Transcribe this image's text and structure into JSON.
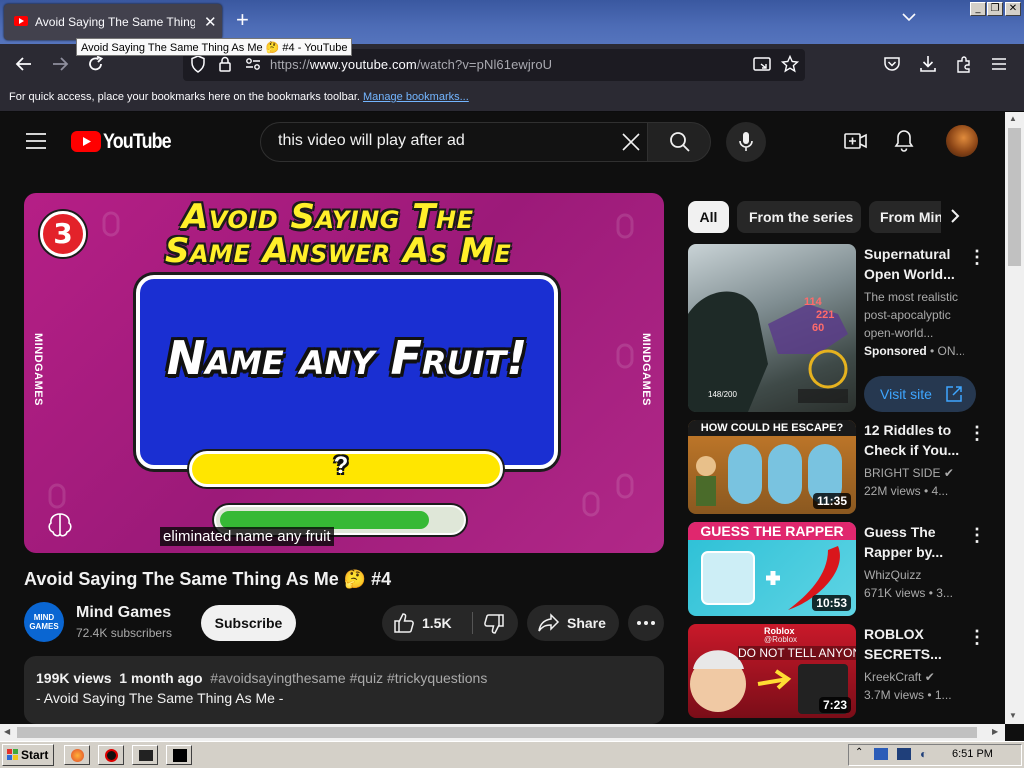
{
  "browser": {
    "tab_title": "Avoid Saying The Same Thing As Me",
    "tooltip": "Avoid Saying The Same Thing As Me 🤔 #4 - YouTube",
    "url_prefix": "https://",
    "url_host": "www.youtube.com",
    "url_path": "/watch?v=pNl61ewjroU",
    "bookmarks_hint": "For quick access, place your bookmarks here on the bookmarks toolbar.",
    "bookmarks_link": "Manage bookmarks..."
  },
  "youtube": {
    "logo_text": "YouTube",
    "search_value": "this video will play after ad"
  },
  "player": {
    "round_number": "3",
    "heading_line1": "Avoid Saying The",
    "heading_line2": "Same Answer As Me",
    "prompt": "Name any Fruit!",
    "question_mark": "?",
    "side_label": "MINDGAMES",
    "caption": "eliminated name any fruit",
    "progress": 0.87
  },
  "video": {
    "title": "Avoid Saying The Same Thing As Me 🤔 #4",
    "channel_avatar_text": "MIND GAMES",
    "channel_name": "Mind Games",
    "subscribers": "72.4K subscribers",
    "subscribe_label": "Subscribe",
    "likes": "1.5K",
    "share_label": "Share",
    "views": "199K views",
    "age": "1 month ago",
    "tags": "#avoidsayingthesame #quiz #trickyquestions",
    "description_line": "- Avoid Saying The Same Thing As Me -"
  },
  "chips": [
    "All",
    "From the series",
    "From Mind Games"
  ],
  "sidebar": [
    {
      "title_line1": "Supernatural",
      "title_line2": "Open World...",
      "meta_line1": "The most realistic",
      "meta_line2": "post-apocalyptic",
      "meta_line3": "open-world...",
      "sponsored": "Sponsored",
      "sponsored_extra": " • ON...",
      "cta": "Visit site",
      "thumb_hp": "148/200",
      "thumb_dmg1": "114",
      "thumb_dmg2": "221",
      "thumb_dmg3": "60"
    },
    {
      "title_line1": "12 Riddles to",
      "title_line2": "Check if You...",
      "channel": "BRIGHT SIDE",
      "stats": "22M views  • 4...",
      "duration": "11:35",
      "thumb_text": "HOW COULD HE ESCAPE?"
    },
    {
      "title_line1": "Guess The",
      "title_line2": "Rapper by...",
      "channel": "WhizQuizz",
      "stats": "671K views  • 3...",
      "duration": "10:53",
      "thumb_text": "GUESS THE RAPPER"
    },
    {
      "title_line1": "ROBLOX",
      "title_line2": "SECRETS...",
      "channel": "KreekCraft",
      "stats": "3.7M views  • 1...",
      "duration": "7:23",
      "thumb_text": "DO NOT TELL ANYONE",
      "thumb_badge": "Roblox",
      "thumb_handle": "@Roblox"
    }
  ],
  "taskbar": {
    "start_label": "Start",
    "clock": "6:51 PM"
  },
  "colors": {
    "yt_red": "#ff0000",
    "link_blue": "#3ea6ff",
    "player_magenta": "#a81e7f",
    "quiz_blue": "#1a2fd2",
    "quiz_yellow": "#ffe600",
    "quiz_green": "#36b935"
  },
  "icons": [
    "menu-icon",
    "youtube-logo-icon",
    "clear-icon",
    "search-icon",
    "mic-icon",
    "create-icon",
    "bell-icon",
    "like-icon",
    "dislike-icon",
    "share-icon",
    "more-icon",
    "chevron-right-icon",
    "back-icon",
    "forward-icon",
    "reload-icon",
    "shield-icon",
    "lock-icon",
    "pocket-icon",
    "download-icon",
    "extensions-icon",
    "hamburger-icon"
  ]
}
